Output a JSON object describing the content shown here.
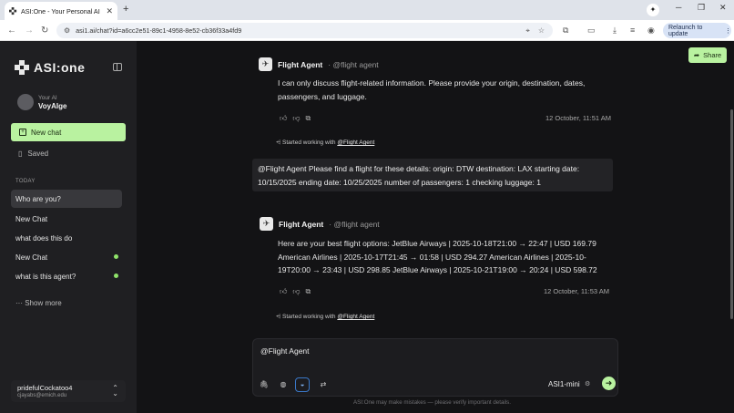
{
  "browser": {
    "tab_title": "ASI:One - Your Personal AI",
    "tab_close": "✕",
    "new_tab": "+",
    "url": "asi1.ai/chat?id=a6cc2e51-89c1-4958-8e52-cb36f33a4fd9",
    "relaunch_label": "Relaunch to update"
  },
  "sidebar": {
    "logo_text": "ASI:one",
    "user_subtitle": "Your AI",
    "user_name": "VoyAIge",
    "new_chat_label": "New chat",
    "saved_label": "Saved",
    "today_label": "TODAY",
    "history": [
      {
        "label": "Who are you?"
      },
      {
        "label": "New Chat"
      },
      {
        "label": "what does this do"
      },
      {
        "label": "New Chat"
      },
      {
        "label": "what is this agent?"
      }
    ],
    "show_more": "Show more",
    "account_name": "pridefulCockatoo4",
    "account_email": "cjayabs@emich.edu"
  },
  "main": {
    "share_label": "Share",
    "messages": [
      {
        "agent_name": "Flight Agent",
        "agent_handle": "· @flight agent",
        "text_lines": [
          "I can only discuss flight-related information. Please provide your origin, destination, dates,",
          "passengers, and luggage."
        ],
        "timestamp": "12 October, 11:51 AM",
        "started_prefix": "Started working with",
        "started_link": "@Flight Agent"
      },
      {
        "user_lines": [
          "@Flight Agent Please find a flight for these details: origin: DTW destination: LAX starting date:",
          "10/15/2025 ending date: 10/25/2025 number of passengers: 1 checking luggage: 1"
        ]
      },
      {
        "agent_name": "Flight Agent",
        "agent_handle": "· @flight agent",
        "text_lines": [
          "Here are your best flight options: JetBlue Airways | 2025-10-18T21:00 → 22:47 | USD 169.79",
          "American Airlines | 2025-10-17T21:45 → 01:58 | USD 294.27 American Airlines | 2025-10-",
          "19T20:00 → 23:43 | USD 298.85 JetBlue Airways | 2025-10-21T19:00 → 20:24 | USD 598.72"
        ],
        "timestamp": "12 October, 11:53 AM",
        "started_prefix": "Started working with",
        "started_link": "@Flight Agent"
      }
    ],
    "composer_text": "@Flight Agent",
    "model_label": "ASI1-mini",
    "disclaimer": "ASI:One may make mistakes — please verify important details."
  },
  "colors": {
    "accent_green": "#b9f2a0",
    "sidebar_bg": "#1f1f22",
    "main_bg": "#131315"
  }
}
